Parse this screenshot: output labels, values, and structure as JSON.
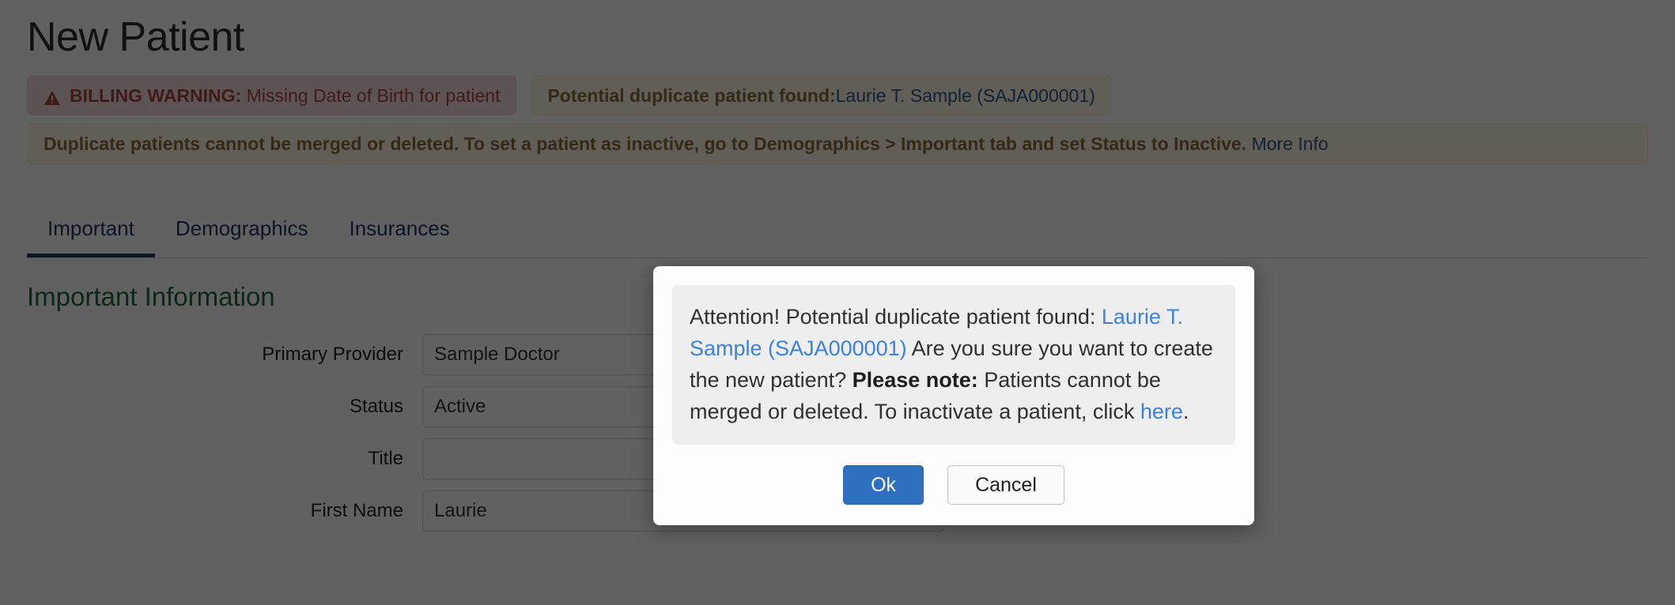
{
  "page": {
    "title": "New Patient"
  },
  "alerts": {
    "billing": {
      "icon": "warning-triangle-icon",
      "label": "BILLING WARNING:",
      "text": " Missing Date of Birth for patient"
    },
    "duplicate": {
      "label": "Potential duplicate patient found:",
      "patient_link": " Laurie T. Sample (SAJA000001)"
    },
    "merge_notice": {
      "text": "Duplicate patients cannot be merged or deleted. To set a patient as inactive, go to Demographics > Important tab and set Status to Inactive.",
      "link_text": "More Info"
    }
  },
  "tabs": [
    {
      "label": "Important",
      "active": true
    },
    {
      "label": "Demographics",
      "active": false
    },
    {
      "label": "Insurances",
      "active": false
    }
  ],
  "form": {
    "section_title": "Important Information",
    "fields": [
      {
        "label": "Primary Provider",
        "value": "Sample Doctor"
      },
      {
        "label": "Status",
        "value": "Active"
      },
      {
        "label": "Title",
        "value": ""
      },
      {
        "label": "First Name",
        "value": "Laurie"
      }
    ]
  },
  "modal": {
    "line1": "Attention! Potential duplicate patient found:",
    "patient_link": "Laurie T. Sample (SAJA000001)",
    "line2": "Are you sure you want to create the new patient?",
    "note_label": "Please note:",
    "note_text_before": " Patients cannot be merged or deleted. To inactivate a patient, click ",
    "note_link": "here",
    "note_text_after": ".",
    "ok_label": "Ok",
    "cancel_label": "Cancel"
  },
  "colors": {
    "accent_blue": "#2f6fc0",
    "link_blue": "#3c82dd",
    "tab_blue": "#1f3864",
    "section_green": "#1c6b34",
    "danger": "#a94442",
    "warning": "#8a6d3b"
  }
}
